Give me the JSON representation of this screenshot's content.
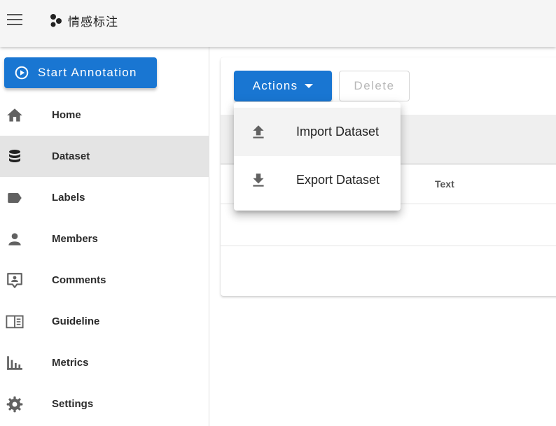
{
  "appbar": {
    "title": "情感标注",
    "menu_icon": "hamburger-menu-icon",
    "brand_icon": "bubbles-logo-icon"
  },
  "sidebar": {
    "start_button": {
      "label": "Start Annotation",
      "icon": "play-circle-icon"
    },
    "active_item": "Dataset",
    "items": [
      {
        "label": "Home",
        "icon": "home-icon"
      },
      {
        "label": "Dataset",
        "icon": "database-icon"
      },
      {
        "label": "Labels",
        "icon": "label-tag-icon"
      },
      {
        "label": "Members",
        "icon": "person-icon"
      },
      {
        "label": "Comments",
        "icon": "comment-account-icon"
      },
      {
        "label": "Guideline",
        "icon": "book-open-icon"
      },
      {
        "label": "Metrics",
        "icon": "bar-chart-icon"
      },
      {
        "label": "Settings",
        "icon": "gear-icon"
      }
    ]
  },
  "toolbar": {
    "actions_label": "Actions",
    "delete_label": "Delete"
  },
  "table": {
    "columns": [
      "Text"
    ]
  },
  "actions_menu": {
    "items": [
      {
        "label": "Import Dataset",
        "icon": "upload-icon"
      },
      {
        "label": "Export Dataset",
        "icon": "download-icon"
      }
    ]
  },
  "colors": {
    "primary": "#1976d2",
    "appbar_bg": "#f5f5f5",
    "active_nav_bg": "#e4e4e4",
    "icon_gray": "#616161"
  }
}
